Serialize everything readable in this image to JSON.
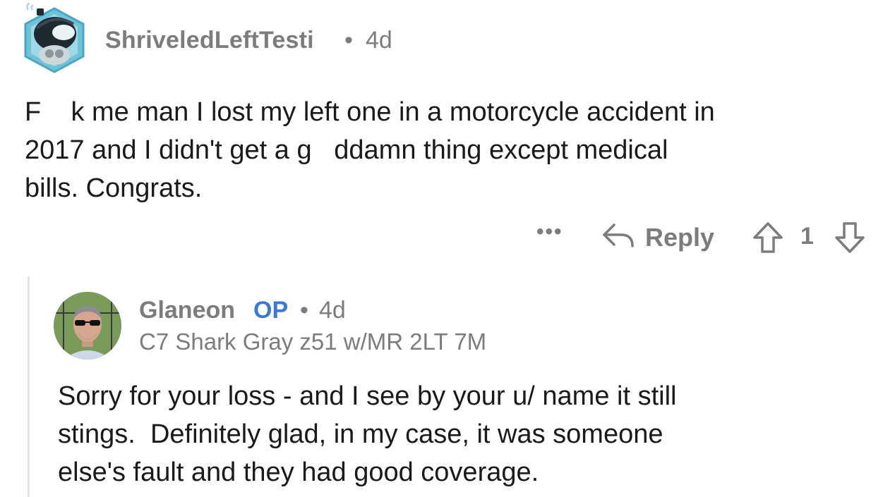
{
  "comment": {
    "username": "ShriveledLeftTesti",
    "separator": "•",
    "age": "4d",
    "avatar_icon": "snoo-avatar-icon",
    "body": "F    k me man I lost my left one in a motorcycle accident in\n2017 and I didn't get a g   ddamn thing except medical\nbills. Congrats.",
    "actions": {
      "more_label": "•••",
      "reply_label": "Reply",
      "vote_count": "1"
    }
  },
  "reply": {
    "username": "Glaneon",
    "op_label": "OP",
    "separator": "•",
    "age": "4d",
    "flair": "C7 Shark Gray z51 w/MR 2LT 7M",
    "avatar_icon": "user-photo-avatar",
    "body": "Sorry for your loss - and I see by your u/ name it still\nstings.  Definitely glad, in my case, it was someone\nelse's fault and they had good coverage."
  },
  "colors": {
    "meta_gray": "#7c7c7c",
    "body_text": "#1a1a1b",
    "op_blue": "#3b78d8",
    "thread_line": "#e4e4e4"
  }
}
